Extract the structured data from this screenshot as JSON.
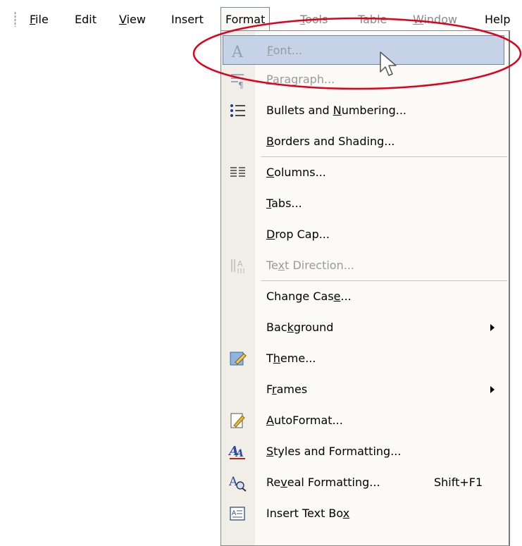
{
  "menubar": {
    "items": [
      {
        "label": "File",
        "accel": "F"
      },
      {
        "label": "Edit",
        "accel": ""
      },
      {
        "label": "View",
        "accel": "V"
      },
      {
        "label": "Insert",
        "accel": ""
      },
      {
        "label": "Format",
        "accel": ""
      },
      {
        "label": "Tools",
        "accel": "T"
      },
      {
        "label": "Table",
        "accel": ""
      },
      {
        "label": "Window",
        "accel": "W"
      },
      {
        "label": "Help",
        "accel": ""
      }
    ]
  },
  "format_menu": {
    "items": [
      {
        "pre": "",
        "u": "F",
        "post": "ont...",
        "icon": "font-icon",
        "state": "highlighted-disabled"
      },
      {
        "pre": "",
        "u": "P",
        "post": "aragraph...",
        "icon": "paragraph-icon",
        "state": "disabled"
      },
      {
        "pre": "Bullets and ",
        "u": "N",
        "post": "umbering...",
        "icon": "bullets-icon"
      },
      {
        "pre": "",
        "u": "B",
        "post": "orders and Shading...",
        "icon": ""
      },
      {
        "pre": "",
        "u": "C",
        "post": "olumns...",
        "icon": "columns-icon"
      },
      {
        "pre": "",
        "u": "T",
        "post": "abs...",
        "icon": ""
      },
      {
        "pre": "",
        "u": "D",
        "post": "rop Cap...",
        "icon": ""
      },
      {
        "pre": "Te",
        "u": "x",
        "post": "t Direction...",
        "icon": "text-direction-icon",
        "state": "disabled"
      },
      {
        "pre": "Change Cas",
        "u": "e",
        "post": "...",
        "icon": ""
      },
      {
        "pre": "Bac",
        "u": "k",
        "post": "ground",
        "icon": "",
        "submenu": true
      },
      {
        "pre": "T",
        "u": "h",
        "post": "eme...",
        "icon": "theme-icon"
      },
      {
        "pre": "F",
        "u": "r",
        "post": "ames",
        "icon": "",
        "submenu": true
      },
      {
        "pre": "",
        "u": "A",
        "post": "utoFormat...",
        "icon": "autoformat-icon"
      },
      {
        "pre": "",
        "u": "S",
        "post": "tyles and Formatting...",
        "icon": "styles-formatting-icon"
      },
      {
        "pre": "Re",
        "u": "v",
        "post": "eal Formatting...",
        "icon": "reveal-formatting-icon",
        "shortcut": "Shift+F1"
      },
      {
        "pre": "Insert Text Bo",
        "u": "x",
        "post": "",
        "icon": "insert-text-box-icon"
      }
    ]
  },
  "colors": {
    "annotation_ellipse": "#e0001b",
    "highlight": "#c6d3e6",
    "highlight_border": "#6f86a6",
    "disabled_text": "#9a9a9a"
  }
}
